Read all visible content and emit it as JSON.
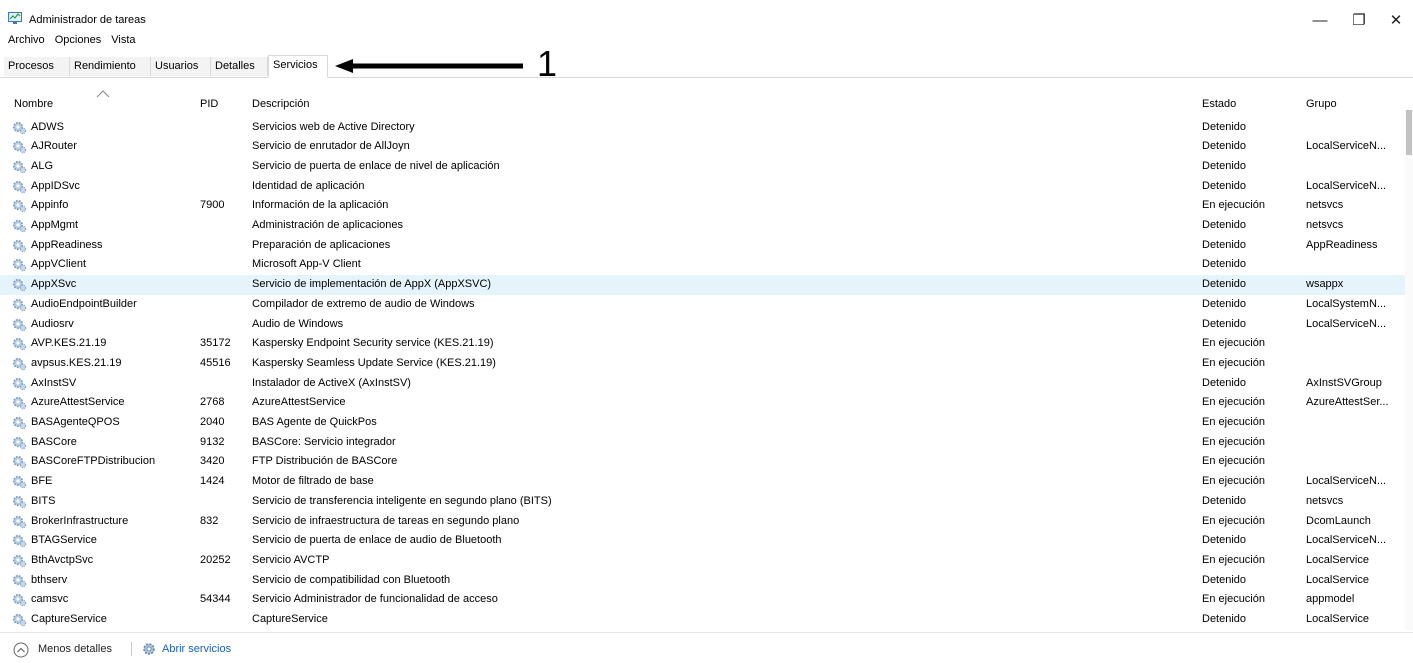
{
  "window": {
    "title": "Administrador de tareas",
    "minimize": "—",
    "maximize": "❐",
    "close": "✕"
  },
  "menu": [
    "Archivo",
    "Opciones",
    "Vista"
  ],
  "tabs": [
    "Procesos",
    "Rendimiento",
    "Usuarios",
    "Detalles",
    "Servicios"
  ],
  "active_tab": "Servicios",
  "annotation": "1",
  "columns": [
    "Nombre",
    "PID",
    "Descripción",
    "Estado",
    "Grupo"
  ],
  "rows": [
    {
      "name": "ADWS",
      "pid": "",
      "desc": "Servicios web de Active Directory",
      "state": "Detenido",
      "group": ""
    },
    {
      "name": "AJRouter",
      "pid": "",
      "desc": "Servicio de enrutador de AllJoyn",
      "state": "Detenido",
      "group": "LocalServiceN..."
    },
    {
      "name": "ALG",
      "pid": "",
      "desc": "Servicio de puerta de enlace de nivel de aplicación",
      "state": "Detenido",
      "group": ""
    },
    {
      "name": "AppIDSvc",
      "pid": "",
      "desc": "Identidad de aplicación",
      "state": "Detenido",
      "group": "LocalServiceN..."
    },
    {
      "name": "Appinfo",
      "pid": "7900",
      "desc": "Información de la aplicación",
      "state": "En ejecución",
      "group": "netsvcs"
    },
    {
      "name": "AppMgmt",
      "pid": "",
      "desc": "Administración de aplicaciones",
      "state": "Detenido",
      "group": "netsvcs"
    },
    {
      "name": "AppReadiness",
      "pid": "",
      "desc": "Preparación de aplicaciones",
      "state": "Detenido",
      "group": "AppReadiness"
    },
    {
      "name": "AppVClient",
      "pid": "",
      "desc": "Microsoft App-V Client",
      "state": "Detenido",
      "group": ""
    },
    {
      "name": "AppXSvc",
      "pid": "",
      "desc": "Servicio de implementación de AppX (AppXSVC)",
      "state": "Detenido",
      "group": "wsappx",
      "highlight": true
    },
    {
      "name": "AudioEndpointBuilder",
      "pid": "",
      "desc": "Compilador de extremo de audio de Windows",
      "state": "Detenido",
      "group": "LocalSystemN..."
    },
    {
      "name": "Audiosrv",
      "pid": "",
      "desc": "Audio de Windows",
      "state": "Detenido",
      "group": "LocalServiceN..."
    },
    {
      "name": "AVP.KES.21.19",
      "pid": "35172",
      "desc": "Kaspersky Endpoint Security service (KES.21.19)",
      "state": "En ejecución",
      "group": ""
    },
    {
      "name": "avpsus.KES.21.19",
      "pid": "45516",
      "desc": "Kaspersky Seamless Update Service (KES.21.19)",
      "state": "En ejecución",
      "group": ""
    },
    {
      "name": "AxInstSV",
      "pid": "",
      "desc": "Instalador de ActiveX (AxInstSV)",
      "state": "Detenido",
      "group": "AxInstSVGroup"
    },
    {
      "name": "AzureAttestService",
      "pid": "2768",
      "desc": "AzureAttestService",
      "state": "En ejecución",
      "group": "AzureAttestSer..."
    },
    {
      "name": "BASAgenteQPOS",
      "pid": "2040",
      "desc": "BAS Agente de QuickPos",
      "state": "En ejecución",
      "group": ""
    },
    {
      "name": "BASCore",
      "pid": "9132",
      "desc": "BASCore: Servicio integrador",
      "state": "En ejecución",
      "group": ""
    },
    {
      "name": "BASCoreFTPDistribucion",
      "pid": "3420",
      "desc": "FTP Distribución de BASCore",
      "state": "En ejecución",
      "group": ""
    },
    {
      "name": "BFE",
      "pid": "1424",
      "desc": "Motor de filtrado de base",
      "state": "En ejecución",
      "group": "LocalServiceN..."
    },
    {
      "name": "BITS",
      "pid": "",
      "desc": "Servicio de transferencia inteligente en segundo plano (BITS)",
      "state": "Detenido",
      "group": "netsvcs"
    },
    {
      "name": "BrokerInfrastructure",
      "pid": "832",
      "desc": "Servicio de infraestructura de tareas en segundo plano",
      "state": "En ejecución",
      "group": "DcomLaunch"
    },
    {
      "name": "BTAGService",
      "pid": "",
      "desc": "Servicio de puerta de enlace de audio de Bluetooth",
      "state": "Detenido",
      "group": "LocalServiceN..."
    },
    {
      "name": "BthAvctpSvc",
      "pid": "20252",
      "desc": "Servicio AVCTP",
      "state": "En ejecución",
      "group": "LocalService"
    },
    {
      "name": "bthserv",
      "pid": "",
      "desc": "Servicio de compatibilidad con Bluetooth",
      "state": "Detenido",
      "group": "LocalService"
    },
    {
      "name": "camsvc",
      "pid": "54344",
      "desc": "Servicio Administrador de funcionalidad de acceso",
      "state": "En ejecución",
      "group": "appmodel"
    },
    {
      "name": "CaptureService",
      "pid": "",
      "desc": "CaptureService",
      "state": "Detenido",
      "group": "LocalService"
    }
  ],
  "footer": {
    "fewer_details": "Menos detalles",
    "open_services": "Abrir servicios"
  },
  "colors": {
    "highlight_row": "#e5f3fb",
    "link": "#1a5fb4",
    "gear": "#7a9cc0"
  }
}
